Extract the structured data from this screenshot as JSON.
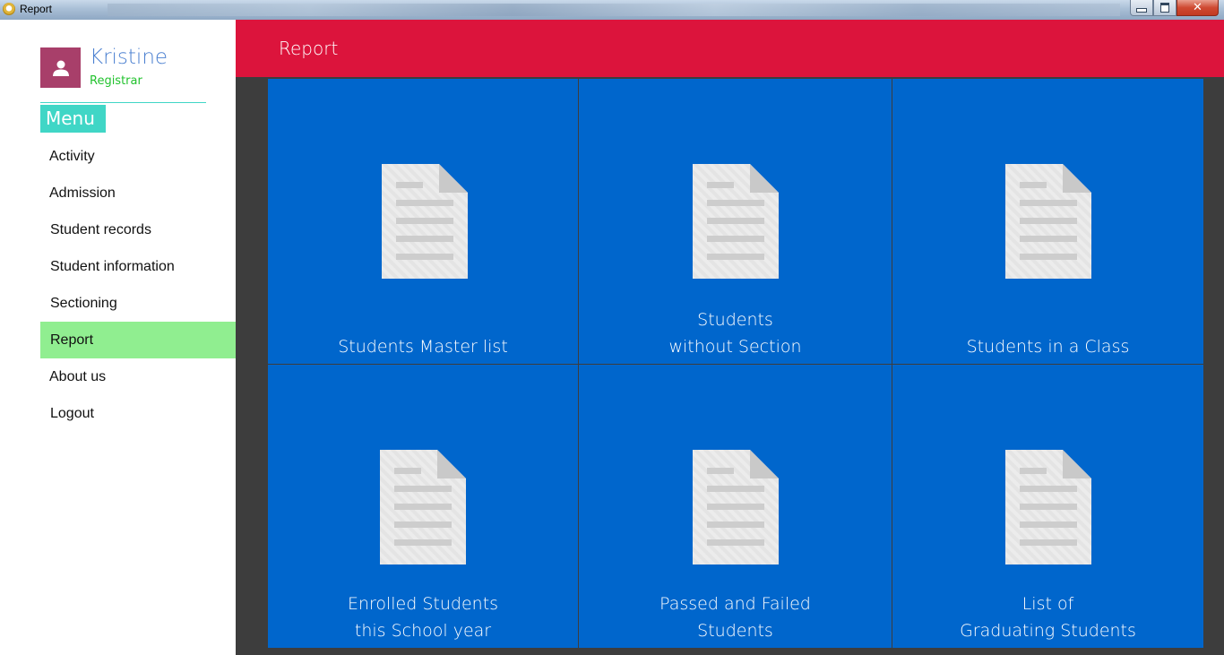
{
  "window": {
    "title": "Report"
  },
  "user": {
    "name": "Kristine",
    "role": "Registrar"
  },
  "menu": {
    "label": "Menu",
    "items": [
      {
        "label": "Activity",
        "active": false
      },
      {
        "label": "Admission",
        "active": false
      },
      {
        "label": "Student records",
        "active": false
      },
      {
        "label": "Student information",
        "active": false
      },
      {
        "label": "Sectioning",
        "active": false
      },
      {
        "label": "Report",
        "active": true
      },
      {
        "label": "About us",
        "active": false
      },
      {
        "label": "Logout",
        "active": false
      }
    ]
  },
  "header": {
    "title": "Report"
  },
  "reports": [
    {
      "line1": "",
      "line2": "Students Master list",
      "icon": "document-icon"
    },
    {
      "line1": "Students",
      "line2": "without Section",
      "icon": "document-icon"
    },
    {
      "line1": "",
      "line2": "Students in a Class",
      "icon": "document-icon"
    },
    {
      "line1": "Enrolled Students",
      "line2": "this School year",
      "icon": "document-icon"
    },
    {
      "line1": "Passed and Failed",
      "line2": "Students",
      "icon": "document-icon"
    },
    {
      "line1": "List of",
      "line2": "Graduating Students",
      "icon": "document-icon"
    }
  ],
  "colors": {
    "header": "#dc143c",
    "tile": "#0066cc",
    "active_item": "#90ee90",
    "menu_accent": "#40d6c6",
    "avatar": "#a83f6a"
  }
}
